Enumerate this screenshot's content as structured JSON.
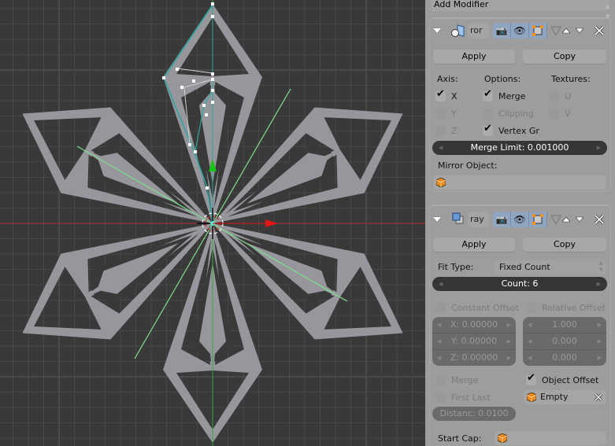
{
  "viewport": {
    "background": "#393939",
    "grid_color": "#474747",
    "grid_major_color": "#5a5a5a",
    "mesh_color": "#96969c",
    "selected_edge_color": "#2aa7a0",
    "x_axis_color": "#b5302a",
    "y_axis_color": "#3aa83a",
    "mirror_line_color": "#7de08c",
    "gizmo": {
      "x_arrow_color": "#e01515",
      "y_arrow_color": "#16c516"
    }
  },
  "panel": {
    "add_modifier_label": "Add Modifier",
    "mirror_modifier": {
      "name": "ror",
      "icon": "mirror-modifier-icon",
      "toggles": [
        "render-icon",
        "eye-icon",
        "editmode-icon",
        "cage-icon"
      ],
      "apply_label": "Apply",
      "copy_label": "Copy",
      "axis_header": "Axis:",
      "options_header": "Options:",
      "textures_header": "Textures:",
      "axis": [
        {
          "label": "X",
          "checked": true,
          "enabled": true
        },
        {
          "label": "Y",
          "checked": false,
          "enabled": false
        },
        {
          "label": "Z",
          "checked": false,
          "enabled": false
        }
      ],
      "options": [
        {
          "label": "Merge",
          "checked": true,
          "enabled": true
        },
        {
          "label": "Clipping",
          "checked": false,
          "enabled": false
        },
        {
          "label": "Vertex Gr",
          "checked": true,
          "enabled": true
        }
      ],
      "textures": [
        {
          "label": "U",
          "checked": false,
          "enabled": false
        },
        {
          "label": "V",
          "checked": false,
          "enabled": false
        }
      ],
      "merge_limit": "Merge Limit: 0.001000",
      "mirror_object_label": "Mirror Object:",
      "mirror_object_value": ""
    },
    "array_modifier": {
      "name": "ray",
      "icon": "array-modifier-icon",
      "apply_label": "Apply",
      "copy_label": "Copy",
      "fit_type_label": "Fit Type:",
      "fit_type_value": "Fixed Count",
      "count": "Count: 6",
      "constant_offset": {
        "label": "Constant Offset",
        "checked": false,
        "values": [
          "X: 0.00000",
          "Y: 0.00000",
          "Z: 0.00000"
        ]
      },
      "relative_offset": {
        "label": "Relative Offset",
        "checked": false,
        "values": [
          "1.000",
          "0.000",
          "0.000"
        ]
      },
      "merge": {
        "label": "Merge",
        "checked": false
      },
      "first_last": {
        "label": "First Last",
        "checked": false
      },
      "distance": "Distanc: 0.0100",
      "object_offset": {
        "label": "Object Offset",
        "checked": true,
        "object": "Empty"
      },
      "start_cap_label": "Start Cap:",
      "start_cap_value": ""
    }
  }
}
